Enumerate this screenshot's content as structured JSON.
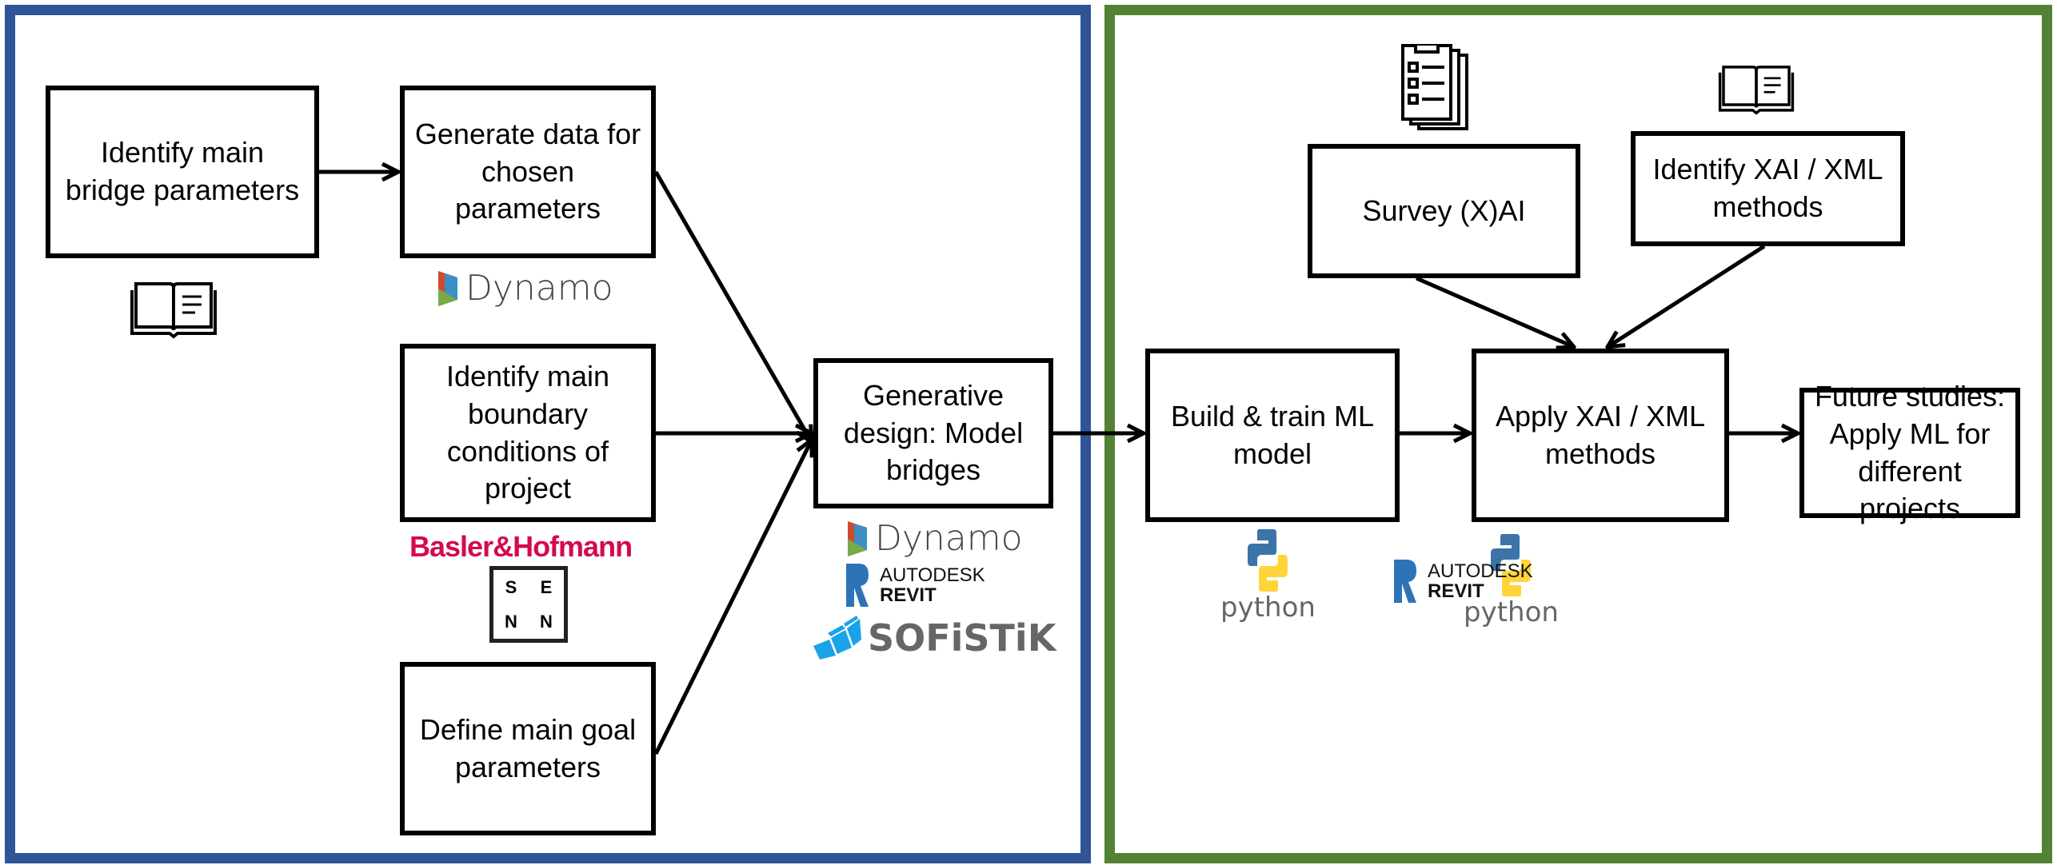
{
  "colors": {
    "left_panel": "#2F5597",
    "right_panel": "#548235",
    "box_border": "#000000"
  },
  "boxes": {
    "bridge_params": "Identify main bridge parameters",
    "generate_data": "Generate data for chosen parameters",
    "boundary": "Identify main boundary conditions of project",
    "goal": "Define main goal parameters",
    "generative": "Generative design: Model bridges",
    "survey": "Survey (X)AI",
    "identify_xai": "Identify XAI / XML methods",
    "build": "Build & train ML model",
    "apply": "Apply XAI / XML methods",
    "future": "Future studies: Apply ML for different projects"
  },
  "logos": {
    "dynamo": "Dynamo",
    "basler": "Basler&Hofmann",
    "senn": [
      "S",
      "E",
      "N",
      "N"
    ],
    "autodesk": "AUTODESK",
    "revit": "REVIT",
    "sofistik": "SOFiSTiK",
    "python": "python"
  },
  "icons": [
    "book-icon",
    "checklist-icon",
    "dynamo-logo",
    "revit-logo",
    "sofistik-logo",
    "python-logo"
  ]
}
